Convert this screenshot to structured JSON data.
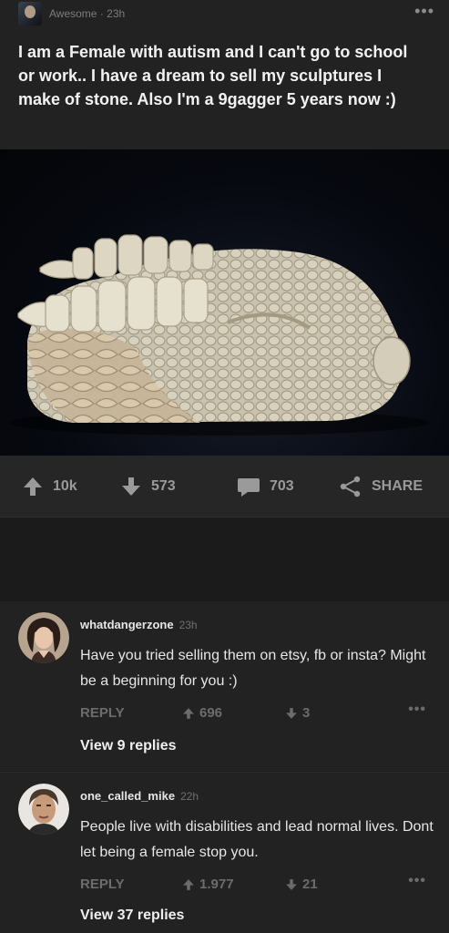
{
  "post": {
    "section": "Awesome",
    "time": "23h",
    "more_label": "•••",
    "title": "I am a Female with autism and I can't go to school or work.. I have a dream to sell my sculptures I make of stone. Also I'm a 9gagger 5 years now :)",
    "image_icon": "dragon-head-sculpture"
  },
  "actions": {
    "upvotes": "10k",
    "downvotes": "573",
    "comments": "703",
    "share_label": "SHARE"
  },
  "comments": [
    {
      "user": "whatdangerzone",
      "time": "23h",
      "text": "Have you tried selling them on etsy, fb or insta? Might be a beginning for you :)",
      "reply_label": "REPLY",
      "upvotes": "696",
      "downvotes": "3",
      "more_label": "•••",
      "view_replies": "View 9 replies"
    },
    {
      "user": "one_called_mike",
      "time": "22h",
      "text": "People live with disabilities and lead normal lives. Dont let being a female stop you.",
      "reply_label": "REPLY",
      "upvotes": "1.977",
      "downvotes": "21",
      "more_label": "•••",
      "view_replies": "View 37 replies"
    }
  ],
  "colors": {
    "background": "#1b1b1b",
    "card": "#222222",
    "muted": "#7c7c7c"
  }
}
